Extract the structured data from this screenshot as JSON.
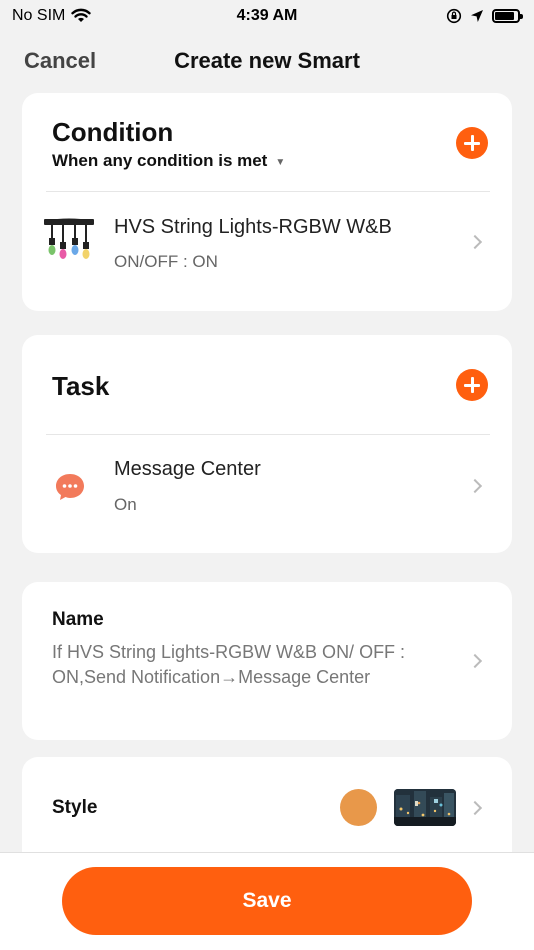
{
  "status_bar": {
    "carrier": "No SIM",
    "time": "4:39 AM"
  },
  "nav": {
    "cancel_label": "Cancel",
    "title": "Create new Smart"
  },
  "condition": {
    "title": "Condition",
    "mode": "When any condition is met",
    "items": [
      {
        "title": "HVS String Lights-RGBW W&B",
        "subtitle": "ON/OFF : ON",
        "icon": "string-lights-icon"
      }
    ]
  },
  "task": {
    "title": "Task",
    "items": [
      {
        "title": "Message Center",
        "subtitle": "On",
        "icon": "message-center-icon"
      }
    ]
  },
  "name_section": {
    "label": "Name",
    "value": "If HVS String Lights-RGBW W&B ON/ OFF : ON,Send Notification→Message Center"
  },
  "style_section": {
    "label": "Style",
    "color": "#e8984a"
  },
  "footer": {
    "save_label": "Save"
  },
  "colors": {
    "accent": "#ff5f0f",
    "background": "#f2f2f2",
    "card": "#ffffff"
  }
}
